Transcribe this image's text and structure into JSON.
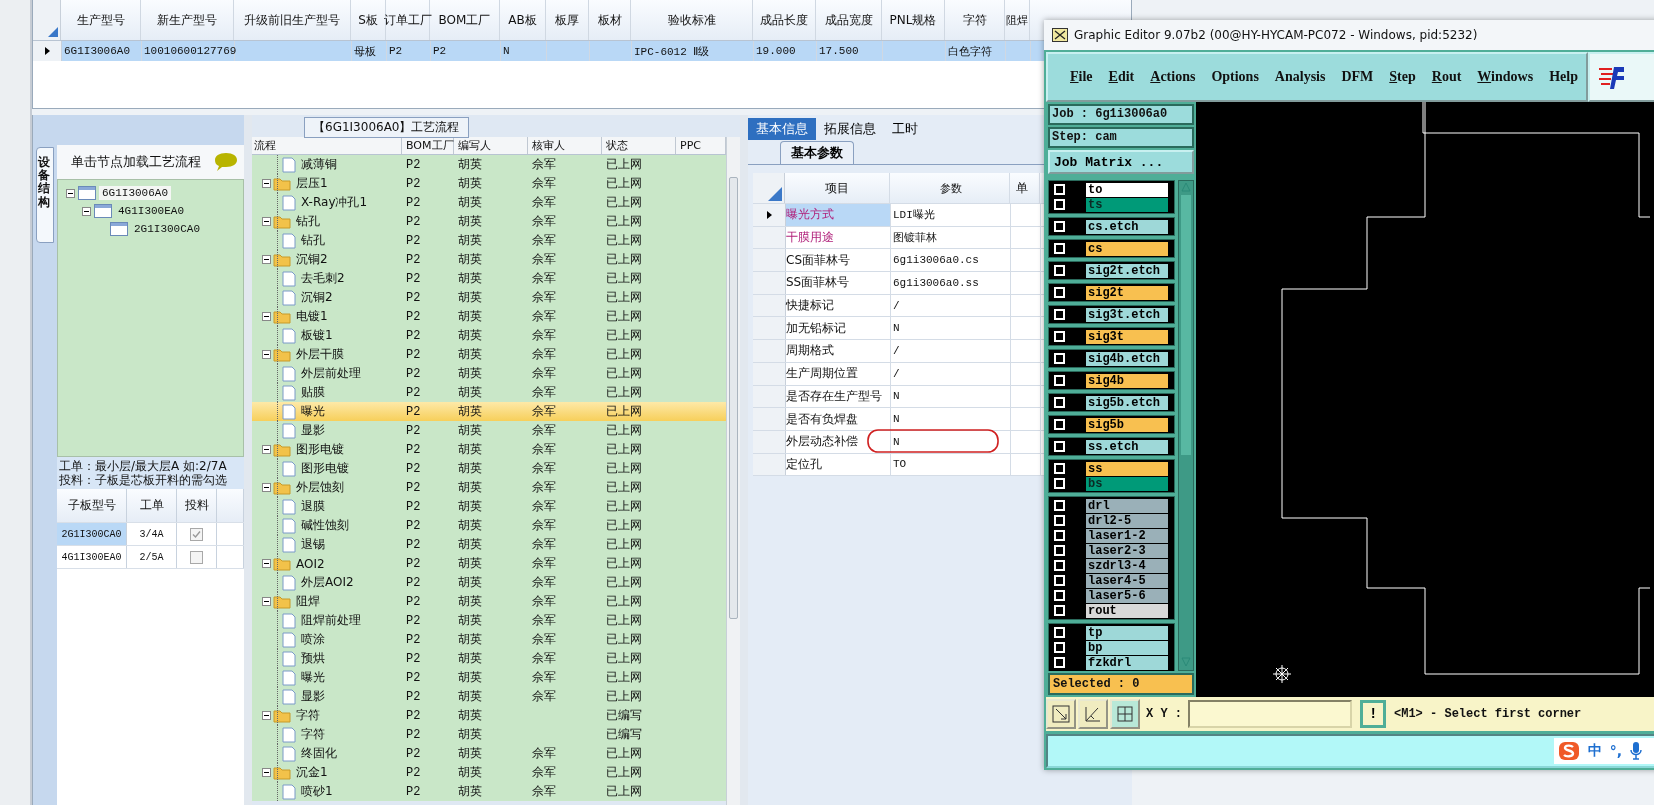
{
  "orders_table": {
    "columns": [
      "生产型号",
      "新生产型号",
      "升级前旧生产型号",
      "S板",
      "订单工厂",
      "BOM工厂",
      "AB板",
      "板厚",
      "板材",
      "验收标准",
      "成品长度",
      "成品宽度",
      "PNL规格",
      "字符",
      "阻焊"
    ],
    "rows": [
      {
        "selected": true,
        "cells": [
          "6G1I3006A0",
          "10010600127769",
          null,
          "母板",
          "P2",
          "P2",
          "N",
          null,
          null,
          "IPC-6012 Ⅱ级",
          "19.000",
          "17.500",
          null,
          "白色字符",
          null
        ]
      }
    ]
  },
  "structure_panel": {
    "tab": "设备结构",
    "hint": "单击节点加载工艺流程",
    "tree": [
      {
        "label": "6G1I3006A0",
        "selected": true,
        "expanded": true,
        "children": [
          {
            "label": "4G1I300EA0",
            "selected": false,
            "expanded": true,
            "children": [
              {
                "label": "2G1I300CA0",
                "selected": false
              }
            ]
          }
        ]
      }
    ],
    "notes": [
      "工单：最小层/最大层A 如:2/7A",
      "投料：子板是芯板开料的需勾选"
    ],
    "subboards": {
      "columns": [
        "子板型号",
        "工单",
        "投料"
      ],
      "rows": [
        {
          "model": "2G1I300CA0",
          "order": "3/4A",
          "feed": true,
          "selected": true
        },
        {
          "model": "4G1I300EA0",
          "order": "2/5A",
          "feed": false,
          "selected": false
        }
      ]
    }
  },
  "flow": {
    "title": "【6G1I3006A0】工艺流程",
    "columns": [
      "流程",
      "BOM工厂",
      "编写人",
      "核审人",
      "状态",
      "PPC"
    ],
    "items": [
      {
        "kind": "step",
        "name": "减薄铜",
        "bom": "P2",
        "writer": "胡英",
        "reviewer": "佘军",
        "status": "已上网",
        "selected": false
      },
      {
        "kind": "group",
        "name": "层压1",
        "bom": "P2",
        "writer": "胡英",
        "reviewer": "佘军",
        "status": "已上网",
        "selected": false,
        "expanded": true,
        "children": [
          {
            "kind": "step",
            "name": "X-Ray冲孔1",
            "bom": "P2",
            "writer": "胡英",
            "reviewer": "佘军",
            "status": "已上网",
            "selected": false
          }
        ]
      },
      {
        "kind": "group",
        "name": "钻孔",
        "bom": "P2",
        "writer": "胡英",
        "reviewer": "佘军",
        "status": "已上网",
        "selected": false,
        "expanded": true,
        "children": [
          {
            "kind": "step",
            "name": "钻孔",
            "bom": "P2",
            "writer": "胡英",
            "reviewer": "佘军",
            "status": "已上网",
            "selected": false
          }
        ]
      },
      {
        "kind": "group",
        "name": "沉铜2",
        "bom": "P2",
        "writer": "胡英",
        "reviewer": "佘军",
        "status": "已上网",
        "selected": false,
        "expanded": true,
        "children": [
          {
            "kind": "step",
            "name": "去毛刺2",
            "bom": "P2",
            "writer": "胡英",
            "reviewer": "佘军",
            "status": "已上网",
            "selected": false
          },
          {
            "kind": "step",
            "name": "沉铜2",
            "bom": "P2",
            "writer": "胡英",
            "reviewer": "佘军",
            "status": "已上网",
            "selected": false
          }
        ]
      },
      {
        "kind": "group",
        "name": "电镀1",
        "bom": "P2",
        "writer": "胡英",
        "reviewer": "佘军",
        "status": "已上网",
        "selected": false,
        "expanded": true,
        "children": [
          {
            "kind": "step",
            "name": "板镀1",
            "bom": "P2",
            "writer": "胡英",
            "reviewer": "佘军",
            "status": "已上网",
            "selected": false
          }
        ]
      },
      {
        "kind": "group",
        "name": "外层干膜",
        "bom": "P2",
        "writer": "胡英",
        "reviewer": "佘军",
        "status": "已上网",
        "selected": false,
        "expanded": true,
        "children": [
          {
            "kind": "step",
            "name": "外层前处理",
            "bom": "P2",
            "writer": "胡英",
            "reviewer": "佘军",
            "status": "已上网",
            "selected": false
          },
          {
            "kind": "step",
            "name": "贴膜",
            "bom": "P2",
            "writer": "胡英",
            "reviewer": "佘军",
            "status": "已上网",
            "selected": false
          },
          {
            "kind": "step",
            "name": "曝光",
            "bom": "P2",
            "writer": "胡英",
            "reviewer": "佘军",
            "status": "已上网",
            "selected": true
          },
          {
            "kind": "step",
            "name": "显影",
            "bom": "P2",
            "writer": "胡英",
            "reviewer": "佘军",
            "status": "已上网",
            "selected": false
          }
        ]
      },
      {
        "kind": "group",
        "name": "图形电镀",
        "bom": "P2",
        "writer": "胡英",
        "reviewer": "佘军",
        "status": "已上网",
        "selected": false,
        "expanded": true,
        "children": [
          {
            "kind": "step",
            "name": "图形电镀",
            "bom": "P2",
            "writer": "胡英",
            "reviewer": "佘军",
            "status": "已上网",
            "selected": false
          }
        ]
      },
      {
        "kind": "group",
        "name": "外层蚀刻",
        "bom": "P2",
        "writer": "胡英",
        "reviewer": "佘军",
        "status": "已上网",
        "selected": false,
        "expanded": true,
        "children": [
          {
            "kind": "step",
            "name": "退膜",
            "bom": "P2",
            "writer": "胡英",
            "reviewer": "佘军",
            "status": "已上网",
            "selected": false
          },
          {
            "kind": "step",
            "name": "碱性蚀刻",
            "bom": "P2",
            "writer": "胡英",
            "reviewer": "佘军",
            "status": "已上网",
            "selected": false
          },
          {
            "kind": "step",
            "name": "退锡",
            "bom": "P2",
            "writer": "胡英",
            "reviewer": "佘军",
            "status": "已上网",
            "selected": false
          }
        ]
      },
      {
        "kind": "group",
        "name": "AOI2",
        "bom": "P2",
        "writer": "胡英",
        "reviewer": "佘军",
        "status": "已上网",
        "selected": false,
        "expanded": true,
        "children": [
          {
            "kind": "step",
            "name": "外层AOI2",
            "bom": "P2",
            "writer": "胡英",
            "reviewer": "佘军",
            "status": "已上网",
            "selected": false
          }
        ]
      },
      {
        "kind": "group",
        "name": "阻焊",
        "bom": "P2",
        "writer": "胡英",
        "reviewer": "佘军",
        "status": "已上网",
        "selected": false,
        "expanded": true,
        "children": [
          {
            "kind": "step",
            "name": "阻焊前处理",
            "bom": "P2",
            "writer": "胡英",
            "reviewer": "佘军",
            "status": "已上网",
            "selected": false
          },
          {
            "kind": "step",
            "name": "喷涂",
            "bom": "P2",
            "writer": "胡英",
            "reviewer": "佘军",
            "status": "已上网",
            "selected": false
          },
          {
            "kind": "step",
            "name": "预烘",
            "bom": "P2",
            "writer": "胡英",
            "reviewer": "佘军",
            "status": "已上网",
            "selected": false
          },
          {
            "kind": "step",
            "name": "曝光",
            "bom": "P2",
            "writer": "胡英",
            "reviewer": "佘军",
            "status": "已上网",
            "selected": false
          },
          {
            "kind": "step",
            "name": "显影",
            "bom": "P2",
            "writer": "胡英",
            "reviewer": "佘军",
            "status": "已上网",
            "selected": false
          }
        ]
      },
      {
        "kind": "group",
        "name": "字符",
        "bom": "P2",
        "writer": "胡英",
        "status": "已编写",
        "selected": false,
        "expanded": true,
        "children": [
          {
            "kind": "step",
            "name": "字符",
            "bom": "P2",
            "writer": "胡英",
            "status": "已编写",
            "selected": false
          },
          {
            "kind": "step",
            "name": "终固化",
            "bom": "P2",
            "writer": "胡英",
            "reviewer": "佘军",
            "status": "已上网",
            "selected": false
          }
        ]
      },
      {
        "kind": "group",
        "name": "沉金1",
        "bom": "P2",
        "writer": "胡英",
        "reviewer": "佘军",
        "status": "已上网",
        "selected": false,
        "expanded": true,
        "children": [
          {
            "kind": "step",
            "name": "喷砂1",
            "bom": "P2",
            "writer": "胡英",
            "reviewer": "佘军",
            "status": "已上网",
            "selected": false
          }
        ]
      }
    ]
  },
  "params": {
    "tabs": [
      {
        "label": "基本信息",
        "selected": true
      },
      {
        "label": "拓展信息",
        "selected": false
      },
      {
        "label": "工时",
        "selected": false
      }
    ],
    "subtab": "基本参数",
    "columns": [
      "项目",
      "参数",
      "单"
    ],
    "rows": [
      {
        "label": "曝光方式",
        "value": "LDI曝光",
        "selected": true,
        "emphasized": true
      },
      {
        "label": "干膜用途",
        "value": "图镀菲林",
        "selected": false,
        "emphasized": true
      },
      {
        "label": "CS面菲林号",
        "value": "6g1i3006a0.cs",
        "selected": false,
        "emphasized": false
      },
      {
        "label": "SS面菲林号",
        "value": "6g1i3006a0.ss",
        "selected": false,
        "emphasized": false
      },
      {
        "label": "快捷标记",
        "value": "/",
        "selected": false,
        "emphasized": false
      },
      {
        "label": "加无铅标记",
        "value": "N",
        "selected": false,
        "emphasized": false
      },
      {
        "label": "周期格式",
        "value": "/",
        "selected": false,
        "emphasized": false
      },
      {
        "label": "生产周期位置",
        "value": "/",
        "selected": false,
        "emphasized": false
      },
      {
        "label": "是否存在生产型号",
        "value": "N",
        "selected": false,
        "emphasized": false
      },
      {
        "label": "是否有负焊盘",
        "value": "N",
        "selected": false,
        "emphasized": false
      },
      {
        "label": "外层动态补偿",
        "value": "N",
        "selected": false,
        "emphasized": false,
        "circled": true
      },
      {
        "label": "定位孔",
        "value": "TO",
        "selected": false,
        "emphasized": false
      }
    ]
  },
  "editor": {
    "title": "Graphic Editor 9.07b2 (00@HY-HYCAM-PC072 - Windows, pid:5232)",
    "menu": [
      {
        "label": "File",
        "mnemonic": true
      },
      {
        "label": "Edit",
        "mnemonic": true
      },
      {
        "label": "Actions",
        "mnemonic": true
      },
      {
        "label": "Options",
        "mnemonic": false
      },
      {
        "label": "Analysis",
        "mnemonic": false
      },
      {
        "label": "DFM",
        "mnemonic": false
      },
      {
        "label": "Step",
        "mnemonic": true
      },
      {
        "label": "Rout",
        "mnemonic": true
      },
      {
        "label": "Windows",
        "mnemonic": true
      },
      {
        "label": "Help",
        "mnemonic": false
      }
    ],
    "job": "Job : 6g1i3006a0",
    "step": "Step: cam",
    "matrix_button": "Job Matrix ...",
    "layer_groups": [
      {
        "layers": [
          {
            "name": "to",
            "color": "#ffffff"
          },
          {
            "name": "ts",
            "color": "#009a78"
          }
        ]
      },
      {
        "layers": [
          {
            "name": "cs.etch",
            "color": "#9ed8d8"
          }
        ]
      },
      {
        "layers": [
          {
            "name": "cs",
            "color": "#f8c050"
          }
        ]
      },
      {
        "layers": [
          {
            "name": "sig2t.etch",
            "color": "#9ed8d8"
          }
        ]
      },
      {
        "layers": [
          {
            "name": "sig2t",
            "color": "#f8c050"
          }
        ]
      },
      {
        "layers": [
          {
            "name": "sig3t.etch",
            "color": "#9ed8d8"
          }
        ]
      },
      {
        "layers": [
          {
            "name": "sig3t",
            "color": "#f8c050"
          }
        ]
      },
      {
        "layers": [
          {
            "name": "sig4b.etch",
            "color": "#9ed8d8"
          }
        ]
      },
      {
        "layers": [
          {
            "name": "sig4b",
            "color": "#f8c050"
          }
        ]
      },
      {
        "layers": [
          {
            "name": "sig5b.etch",
            "color": "#9ed8d8"
          }
        ]
      },
      {
        "layers": [
          {
            "name": "sig5b",
            "color": "#f8c050"
          }
        ]
      },
      {
        "layers": [
          {
            "name": "ss.etch",
            "color": "#9ed8d8"
          }
        ]
      },
      {
        "layers": [
          {
            "name": "ss",
            "color": "#f8c050"
          },
          {
            "name": "bs",
            "color": "#009a78"
          }
        ]
      },
      {
        "layers": [
          {
            "name": "drl",
            "color": "#9ab0b8"
          },
          {
            "name": "drl2-5",
            "color": "#9ab0b8"
          },
          {
            "name": "laser1-2",
            "color": "#9ab0b8"
          },
          {
            "name": "laser2-3",
            "color": "#9ab0b8"
          },
          {
            "name": "szdrl3-4",
            "color": "#9ab0b8"
          },
          {
            "name": "laser4-5",
            "color": "#9ab0b8"
          },
          {
            "name": "laser5-6",
            "color": "#9ab0b8"
          },
          {
            "name": "rout",
            "color": "#d8d8d8"
          }
        ]
      },
      {
        "layers": [
          {
            "name": "tp",
            "color": "#9ed8d8"
          },
          {
            "name": "bp",
            "color": "#9ed8d8"
          },
          {
            "name": "fzkdrl",
            "color": "#9ed8d8"
          }
        ]
      }
    ],
    "selected_count": "Selected : 0",
    "xy_label": "X Y :",
    "alert_button": "!",
    "prompt": "<M1> - Select first corner",
    "ime": {
      "language": "中",
      "punctuation": "°,"
    }
  }
}
